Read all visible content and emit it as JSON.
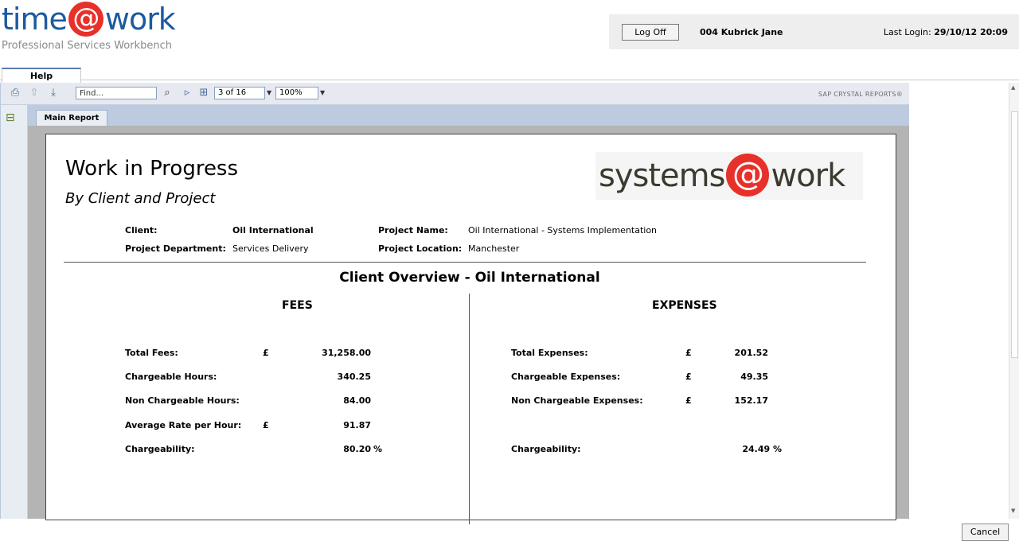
{
  "brand": {
    "pre": "time",
    "at": "@",
    "post": "work",
    "subtitle": "Professional Services Workbench"
  },
  "userbar": {
    "logoff": "Log Off",
    "user": "004 Kubrick Jane",
    "last_login_label": "Last Login:",
    "last_login_value": "29/10/12 20:09"
  },
  "tabs": {
    "help": "Help"
  },
  "toolbar": {
    "find_placeholder": "Find...",
    "page": "3 of 16",
    "zoom": "100%",
    "sap_label": "SAP CRYSTAL REPORTS®"
  },
  "report_tab": "Main Report",
  "report": {
    "title": "Work in Progress",
    "subtitle": "By Client and Project",
    "logo": {
      "pre": "systems",
      "at": "@",
      "post": "work"
    },
    "client_label": "Client:",
    "client_value": "Oil International",
    "dept_label": "Project Department:",
    "dept_value": "Services Delivery",
    "pname_label": "Project Name:",
    "pname_value": "Oil International - Systems Implementation",
    "ploc_label": "Project Location:",
    "ploc_value": "Manchester",
    "overview": "Client Overview - Oil International",
    "fees": {
      "heading": "FEES",
      "rows": [
        {
          "label": "Total Fees:",
          "cur": "£",
          "value": "31,258.00",
          "unit": ""
        },
        {
          "label": "Chargeable Hours:",
          "cur": "",
          "value": "340.25",
          "unit": ""
        },
        {
          "label": "Non Chargeable Hours:",
          "cur": "",
          "value": "84.00",
          "unit": ""
        },
        {
          "label": "Average Rate per Hour:",
          "cur": "£",
          "value": "91.87",
          "unit": ""
        },
        {
          "label": "Chargeability:",
          "cur": "",
          "value": "80.20",
          "unit": "%"
        }
      ]
    },
    "expenses": {
      "heading": "EXPENSES",
      "rows": [
        {
          "label": "Total Expenses:",
          "cur": "£",
          "value": "201.52"
        },
        {
          "label": "Chargeable Expenses:",
          "cur": "£",
          "value": "49.35"
        },
        {
          "label": "Non Chargeable Expenses:",
          "cur": "£",
          "value": "152.17"
        },
        {
          "label": "Chargeability:",
          "cur": "",
          "value": "24.49 %"
        }
      ]
    }
  },
  "cancel": "Cancel"
}
